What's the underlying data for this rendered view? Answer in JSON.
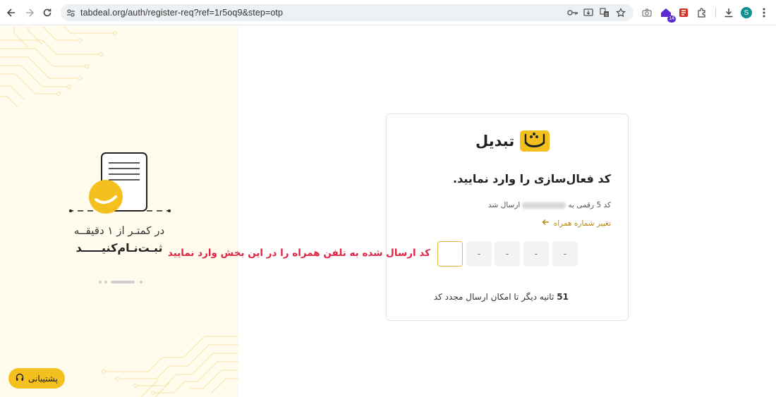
{
  "browser": {
    "url": "tabdeal.org/auth/register-req?ref=1r5oq9&step=otp",
    "avatar_letter": "S",
    "extension_badge": "14"
  },
  "left_panel": {
    "promo_line1": "در کمتـر از ۱ دقیقــه",
    "promo_line2": "ثبـت‌نـام‌کنیـــــد"
  },
  "support": {
    "label": "پشتیبانی"
  },
  "card": {
    "logo_text": "تبدیل",
    "heading": "کد فعال‌سازی را وارد نمایید.",
    "sent_prefix": "کد 5 رقمی به",
    "sent_suffix": "ارسال شد",
    "change_number": "تغییر شماره همراه",
    "otp_placeholders": [
      "-",
      "-",
      "-",
      "-",
      ""
    ],
    "timer_seconds": "51",
    "timer_text": "ثانیه دیگر تا امکان ارسال مجدد کد"
  },
  "annotation": {
    "text": "کد ارسال شده به تلفن همراه را در این بخش وارد نمایید"
  },
  "colors": {
    "brand_yellow": "#f4c01e",
    "annotation_red": "#e02244",
    "link_gold": "#b8860b",
    "panel_bg": "#fffcee"
  }
}
